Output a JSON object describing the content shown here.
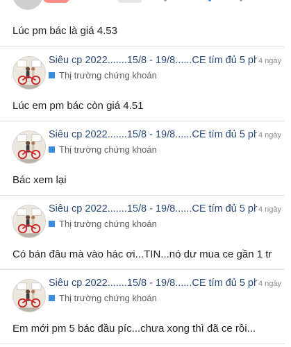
{
  "first_post": {
    "body": "Lúc pm bác là giá 4.53"
  },
  "posts": [
    {
      "title": "Siêu cp 2022.......15/8 - 19/8......CE tím đủ 5 ph...",
      "time": "4 ngày",
      "category": "Thị trường chứng khoán",
      "body": "Lúc em pm bác còn giá 4.51"
    },
    {
      "title": "Siêu cp 2022.......15/8 - 19/8......CE tím đủ 5 ph...",
      "time": "4 ngày",
      "category": "Thị trường chứng khoán",
      "body": "Bác xem lại"
    },
    {
      "title": "Siêu cp 2022.......15/8 - 19/8......CE tím đủ 5 ph...",
      "time": "4 ngày",
      "category": "Thị trường chứng khoán",
      "body": "Có bán đâu mà vào hác ơi...TIN...nó dư mua ce gần 1 tr"
    },
    {
      "title": "Siêu cp 2022.......15/8 - 19/8......CE tím đủ 5 ph...",
      "time": "4 ngày",
      "category": "Thị trường chứng khoán",
      "body": "Em mới pm 5 bác đầu píc...chưa xong thì đã ce rồi..."
    }
  ],
  "colors": {
    "title": "#2a4a7a",
    "category_badge": "#3a8dde",
    "divider": "#e3e3e3",
    "time": "#8a8a8a"
  }
}
